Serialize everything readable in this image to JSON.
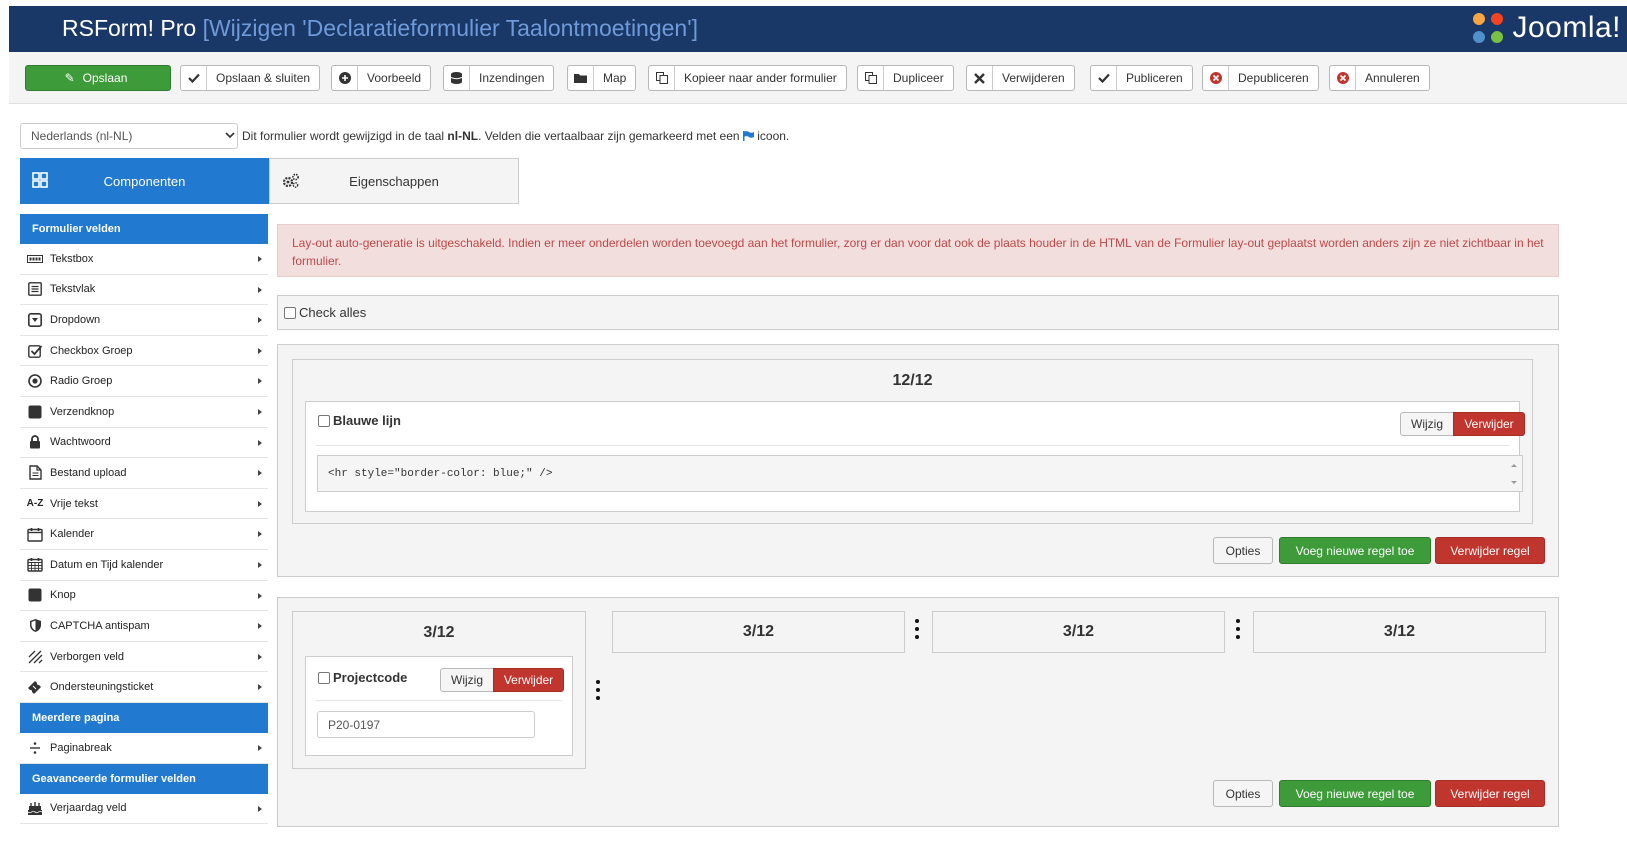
{
  "header": {
    "app": "RSForm! Pro",
    "subtitle": "[Wijzigen 'Declaratieformulier Taalontmoetingen']",
    "logo_text": "Joomla!"
  },
  "toolbar": {
    "save": "Opslaan",
    "save_close": "Opslaan & sluiten",
    "preview": "Voorbeeld",
    "submissions": "Inzendingen",
    "folder": "Map",
    "copy_to_form": "Kopieer naar ander formulier",
    "duplicate": "Dupliceer",
    "delete": "Verwijderen",
    "publish": "Publiceren",
    "unpublish": "Depubliceren",
    "cancel": "Annuleren"
  },
  "language": {
    "selected": "Nederlands (nl-NL)",
    "note_pre": "Dit formulier wordt gewijzigd in de taal ",
    "note_lang": "nl-NL",
    "note_post": ". Velden die vertaalbaar zijn gemarkeerd met een ",
    "note_end": " icoon."
  },
  "tabs": {
    "components": "Componenten",
    "properties": "Eigenschappen"
  },
  "sidebar": {
    "sections": [
      {
        "title": "Formulier velden",
        "items": [
          {
            "label": "Tekstbox",
            "icon": "textbox-icon"
          },
          {
            "label": "Tekstvlak",
            "icon": "textarea-icon"
          },
          {
            "label": "Dropdown",
            "icon": "dropdown-icon"
          },
          {
            "label": "Checkbox Groep",
            "icon": "checkbox-icon"
          },
          {
            "label": "Radio Groep",
            "icon": "radio-icon"
          },
          {
            "label": "Verzendknop",
            "icon": "submit-icon"
          },
          {
            "label": "Wachtwoord",
            "icon": "lock-icon"
          },
          {
            "label": "Bestand upload",
            "icon": "file-icon"
          },
          {
            "label": "Vrije tekst",
            "icon": "az-icon"
          },
          {
            "label": "Kalender",
            "icon": "calendar-icon"
          },
          {
            "label": "Datum en Tijd kalender",
            "icon": "datetime-calendar-icon"
          },
          {
            "label": "Knop",
            "icon": "button-icon"
          },
          {
            "label": "CAPTCHA antispam",
            "icon": "shield-icon"
          },
          {
            "label": "Verborgen veld",
            "icon": "hidden-icon"
          },
          {
            "label": "Ondersteuningsticket",
            "icon": "ticket-icon"
          }
        ]
      },
      {
        "title": "Meerdere pagina",
        "items": [
          {
            "label": "Paginabreak",
            "icon": "divide-icon"
          }
        ]
      },
      {
        "title": "Geavanceerde formulier velden",
        "items": [
          {
            "label": "Verjaardag veld",
            "icon": "cake-icon"
          }
        ]
      }
    ]
  },
  "alert": "Lay-out auto-generatie is uitgeschakeld. Indien er meer onderdelen worden toevoegd aan het formulier, zorg er dan voor dat ook de plaats houder in de HTML van de Formulier lay-out geplaatst worden anders zijn ze niet zichtbaar in het formulier.",
  "check_all": "Check alles",
  "row1": {
    "col_label": "12/12",
    "field_name": "Blauwe lijn",
    "edit": "Wijzig",
    "remove": "Verwijder",
    "code": "<hr style=\"border-color: blue;\" />",
    "options": "Opties",
    "add_row": "Voeg nieuwe regel toe",
    "delete_row": "Verwijder regel"
  },
  "row2": {
    "cols": [
      "3/12",
      "3/12",
      "3/12",
      "3/12"
    ],
    "field_name": "Projectcode",
    "edit": "Wijzig",
    "remove": "Verwijder",
    "value": "P20-0197",
    "options": "Opties",
    "add_row": "Voeg nieuwe regel toe",
    "delete_row": "Verwijder regel"
  },
  "colors": {
    "header_bg": "#1a3867",
    "accent_blue": "#2279d0",
    "green": "#3e9b3a",
    "red": "#c0352d",
    "alert_bg": "#f3dede"
  }
}
